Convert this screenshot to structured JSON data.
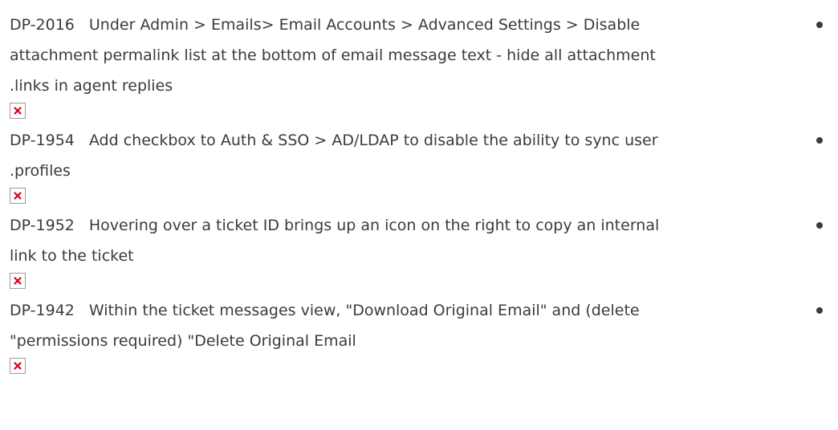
{
  "items": [
    {
      "id": "DP-2016",
      "line1": "Under Admin > Emails> Email Accounts > Advanced Settings > Disable",
      "line2": "attachment permalink list at the bottom of email message text - hide all attachment",
      "line3": ".links in agent replies"
    },
    {
      "id": "DP-1954",
      "line1": "Add checkbox to Auth & SSO > AD/LDAP to disable the ability to sync user",
      "line2": ".profiles"
    },
    {
      "id": "DP-1952",
      "line1": "Hovering over a ticket ID brings up an icon on the right to copy an internal",
      "line2": "link to the ticket"
    },
    {
      "id": "DP-1942",
      "line1": "Within the ticket messages view, \"Download Original Email\" and (delete",
      "line2": "\"permissions required) \"Delete Original Email"
    }
  ],
  "broken_image_icon": "broken-image-icon",
  "colors": {
    "text": "#3b3b3b",
    "broken_image_x": "#d0021b"
  }
}
